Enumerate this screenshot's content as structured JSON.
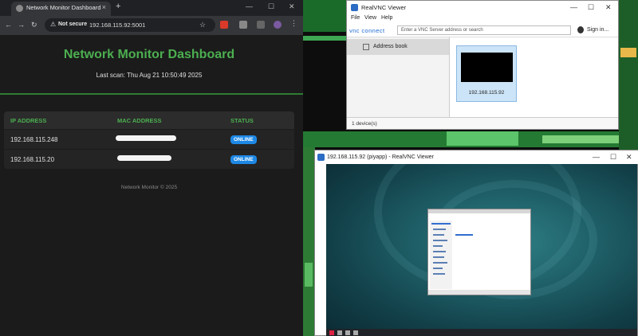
{
  "browser": {
    "tab_title": "Network Monitor Dashboard",
    "tab_close": "×",
    "new_tab": "+",
    "security_label": "Not secure",
    "url": "192.168.115.92:5001"
  },
  "dashboard": {
    "title": "Network Monitor Dashboard",
    "last_scan": "Last scan: Thu Aug 21 10:50:49 2025",
    "columns": [
      "IP ADDRESS",
      "MAC ADDRESS",
      "STATUS"
    ],
    "rows": [
      {
        "ip": "192.168.115.248",
        "mac": "",
        "status": "ONLINE"
      },
      {
        "ip": "192.168.115.20",
        "mac": "",
        "status": "ONLINE"
      }
    ],
    "footer": "Network Monitor © 2025"
  },
  "vnc": {
    "title": "RealVNC Viewer",
    "menu": [
      "File",
      "View",
      "Help"
    ],
    "logo": "vnc connect",
    "search_placeholder": "Enter a VNC Server address or search",
    "sign_in": "Sign in...",
    "address_book": "Address book",
    "device_label": "192.168.115.92",
    "status": "1 device(s)"
  },
  "viewer": {
    "title": "192.168.115.92 (piyapp) - RealVNC Viewer"
  },
  "colors": {
    "accent_green": "#4caf50",
    "badge_blue": "#1e88e5",
    "vnc_blue": "#1e6ad3"
  }
}
